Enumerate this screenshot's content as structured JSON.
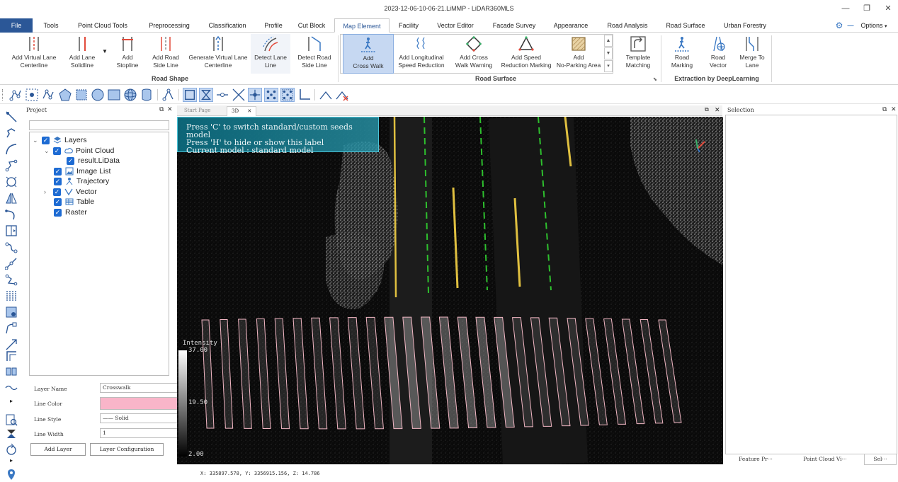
{
  "window": {
    "title": "2023-12-06-10-06-21.LiMMP - LiDAR360MLS"
  },
  "menu": {
    "file": "File",
    "tabs": [
      "Tools",
      "Point Cloud Tools",
      "Preprocessing",
      "Classification",
      "Profile",
      "Cut Block",
      "Map Element",
      "Facility",
      "Vector Editor",
      "Facade Survey",
      "Appearance",
      "Road Analysis",
      "Road Surface",
      "Urban Forestry"
    ],
    "active_tab": "Map Element",
    "options": "Options"
  },
  "ribbon": {
    "road_shape": {
      "label": "Road Shape",
      "buttons": [
        {
          "line1": "Add Virtual Lane",
          "line2": "Centerline"
        },
        {
          "line1": "Add Lane",
          "line2": "Solidline"
        },
        {
          "line1": "Add",
          "line2": "Stopline"
        },
        {
          "line1": "Add Road",
          "line2": "Side Line"
        },
        {
          "line1": "Generate Virtual Lane",
          "line2": "Centerline"
        },
        {
          "line1": "Detect Lane",
          "line2": "Line"
        },
        {
          "line1": "Detect Road",
          "line2": "Side Line"
        }
      ]
    },
    "road_surface": {
      "label": "Road Surface",
      "buttons": [
        {
          "line1": "Add",
          "line2": "Cross Walk"
        },
        {
          "line1": "Add Longitudinal",
          "line2": "Speed Reduction"
        },
        {
          "line1": "Add Cross",
          "line2": "Walk Warning"
        },
        {
          "line1": "Add Speed",
          "line2": "Reduction Marking"
        },
        {
          "line1": "Add",
          "line2": "No-Parking Area"
        }
      ],
      "template": {
        "line1": "Template",
        "line2": "Matching"
      }
    },
    "deeplearning": {
      "label": "Extraction by DeepLearning",
      "buttons": [
        {
          "line1": "Road",
          "line2": "Marking"
        },
        {
          "line1": "Road",
          "line2": "Vector"
        },
        {
          "line1": "Merge To",
          "line2": "Lane"
        }
      ]
    }
  },
  "project": {
    "title": "Project",
    "tree": [
      {
        "label": "Layers",
        "level": 0,
        "expanded": true,
        "icon": "layers-icon"
      },
      {
        "label": "Point Cloud",
        "level": 1,
        "expanded": true,
        "icon": "cloud-icon"
      },
      {
        "label": "result.LiData",
        "level": 2,
        "icon": ""
      },
      {
        "label": "Image List",
        "level": 1,
        "icon": "image-icon"
      },
      {
        "label": "Trajectory",
        "level": 1,
        "icon": "trajectory-icon"
      },
      {
        "label": "Vector",
        "level": 1,
        "collapsed": true,
        "icon": "vector-icon"
      },
      {
        "label": "Table",
        "level": 1,
        "icon": "table-icon"
      },
      {
        "label": "Raster",
        "level": 1,
        "icon": ""
      }
    ],
    "props": {
      "layer_name_label": "Layer Name",
      "layer_name_value": "Crosswalk",
      "line_color_label": "Line Color",
      "line_color_value": "#f9b5c9",
      "line_style_label": "Line Style",
      "line_style_value": "—— Solid",
      "line_width_label": "Line Width",
      "line_width_value": "1",
      "add_layer": "Add Layer",
      "layer_config": "Layer Configuration"
    }
  },
  "viewport": {
    "tabs": [
      "Start Page",
      "3D"
    ],
    "active_tab": "3D",
    "hint_lines": [
      "Press 'C' to switch standard/custom seeds model",
      "Press 'H' to hide or show this label",
      "Current model : standard model"
    ],
    "legend_title": "Intensity",
    "legend_max": "37.00",
    "legend_mid": "19.50",
    "legend_min": "2.00",
    "crosswalk_color": "#f2b7c4"
  },
  "selection": {
    "title": "Selection",
    "tabs": [
      "Feature Pr···",
      "Point Cloud Vi···",
      "Sel···"
    ]
  },
  "status": {
    "coords": "X: 335897.578, Y: 3356915.156, Z: 14.786"
  }
}
